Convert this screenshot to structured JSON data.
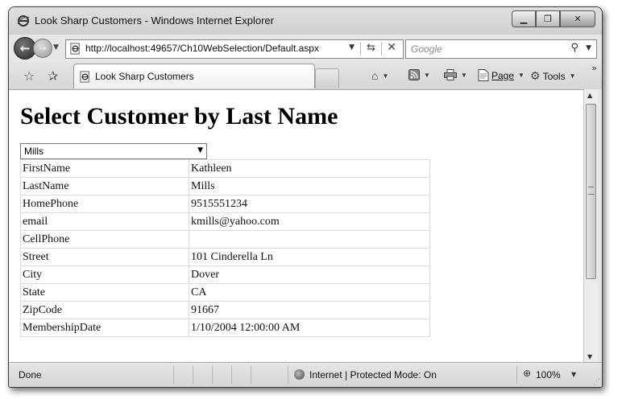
{
  "window": {
    "title": "Look Sharp Customers - Windows Internet Explorer",
    "minimize_glyph": "▁",
    "maximize_glyph": "❐",
    "close_glyph": "✕"
  },
  "nav": {
    "back_glyph": "←",
    "forward_glyph": "→",
    "address": "http://localhost:49657/Ch10WebSelection/Default.aspx",
    "search_placeholder": "Google"
  },
  "tabs": [
    {
      "label": "Look Sharp Customers",
      "active": true
    }
  ],
  "commands": {
    "page_label": "Page",
    "tools_label": "Tools"
  },
  "icons": {
    "ie_logo": "ie-logo-icon",
    "favorites": "favorites-star-icon",
    "add_favorites": "add-favorites-icon",
    "home": "home-icon",
    "feeds": "rss-feed-icon",
    "print": "print-icon",
    "page": "page-icon",
    "tools": "gear-icon",
    "search": "search-icon",
    "refresh": "refresh-icon",
    "stop": "stop-icon",
    "zone": "globe-icon",
    "zoom": "zoom-icon"
  },
  "page": {
    "heading": "Select Customer by Last Name",
    "selected_last_name": "Mills",
    "details": [
      {
        "field": "FirstName",
        "value": "Kathleen"
      },
      {
        "field": "LastName",
        "value": "Mills"
      },
      {
        "field": "HomePhone",
        "value": "9515551234"
      },
      {
        "field": "email",
        "value": "kmills@yahoo.com"
      },
      {
        "field": "CellPhone",
        "value": ""
      },
      {
        "field": "Street",
        "value": "101 Cinderella Ln"
      },
      {
        "field": "City",
        "value": "Dover"
      },
      {
        "field": "State",
        "value": "CA"
      },
      {
        "field": "ZipCode",
        "value": "91667"
      },
      {
        "field": "MembershipDate",
        "value": "1/10/2004 12:00:00 AM"
      }
    ]
  },
  "status": {
    "left": "Done",
    "zone": "Internet | Protected Mode: On",
    "zoom": "100%"
  }
}
